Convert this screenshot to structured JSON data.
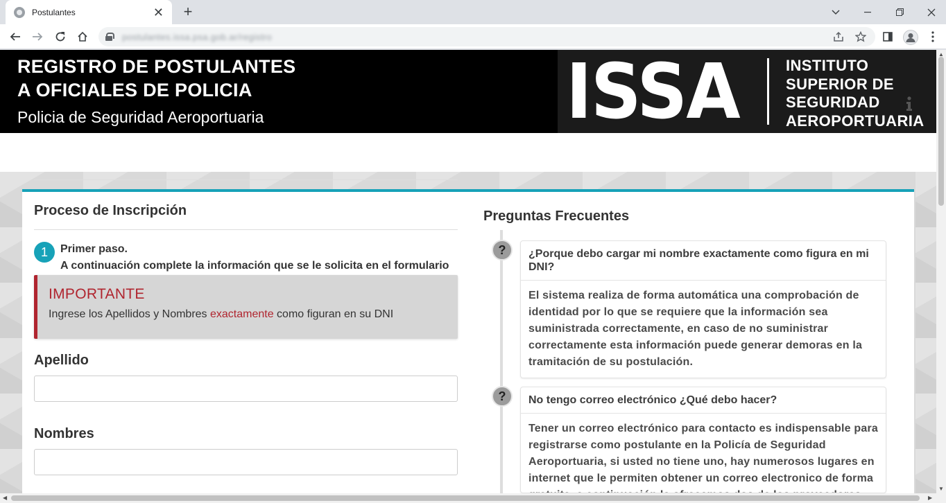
{
  "browser": {
    "tab_title": "Postulantes",
    "new_tab": "+",
    "close": "✕",
    "url": "postulantes.issa.psa.gob.ar/registro"
  },
  "header": {
    "title_line1": "REGISTRO DE POSTULANTES",
    "title_line2": "A OFICIALES DE POLICIA",
    "subtitle": "Policia de Seguridad Aeroportuaria",
    "logo_text": "ISSA",
    "logo_line1": "INSTITUTO",
    "logo_line2": "SUPERIOR DE",
    "logo_line3": "SEGURIDAD",
    "logo_line4": "AEROPORTUARIA"
  },
  "form": {
    "section_title": "Proceso de Inscripción",
    "step_number": "1",
    "step_title": "Primer paso.",
    "step_desc": "A continuación complete la información que se le solicita en el formulario",
    "alert_title": "IMPORTANTE",
    "alert_pre": "Ingrese los Apellidos y Nombres ",
    "alert_highlight": "exactamente",
    "alert_post": " como figuran en su DNI",
    "apellido_label": "Apellido",
    "apellido_value": "",
    "nombres_label": "Nombres",
    "nombres_value": ""
  },
  "faq": {
    "title": "Preguntas Frecuentes",
    "badge": "?",
    "items": [
      {
        "question": "¿Porque debo cargar mi nombre exactamente como figura en mi DNI?",
        "answer": "El sistema realiza de forma automática una comprobación de identidad por lo que se requiere que la información sea suministrada correctamente, en caso de no suministrar correctamente esta información puede generar demoras en la tramitación de su postulación."
      },
      {
        "question": "No tengo correo electrónico ¿Qué debo hacer?",
        "answer": "Tener un correo electrónico para contacto es indispensable para registrarse como postulante en la Policía de Seguridad Aeroportuaria, si usted no tiene uno, hay numerosos lugares en internet que le permiten obtener un correo electronico de forma gratuita, a continuación le ofrecemos dos de los proveedores más"
      }
    ]
  },
  "colors": {
    "accent": "#17a2b8",
    "alert_red": "#b0252f",
    "header_bg": "#000000"
  }
}
